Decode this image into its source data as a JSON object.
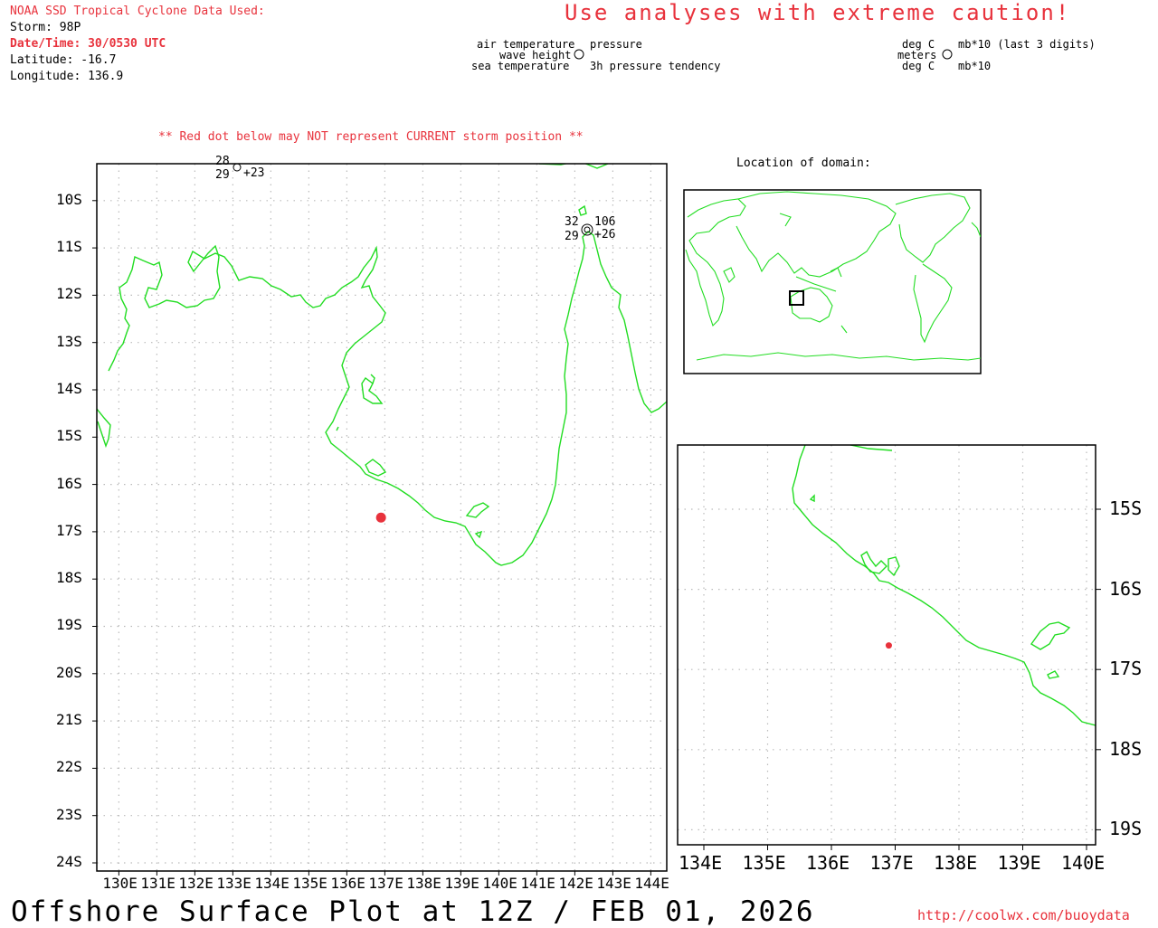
{
  "header": {
    "source": "NOAA SSD Tropical Cyclone Data Used:",
    "storm": "Storm: 98P",
    "datetime": "Date/Time: 30/0530 UTC",
    "latitude": "Latitude: -16.7",
    "longitude": "Longitude: 136.9",
    "caution": "Use analyses with extreme caution!"
  },
  "legend": {
    "air_temperature": "air temperature",
    "wave_height": "wave height",
    "sea_temperature": "sea temperature",
    "pressure": "pressure",
    "pressure_tendency": "3h pressure tendency",
    "deg_c_top": "deg C",
    "meters": "meters",
    "deg_c_bottom": "deg C",
    "mb_last3": "mb*10 (last 3 digits)",
    "mb": "mb*10"
  },
  "main_map": {
    "warning": "** Red dot below may NOT represent CURRENT storm position **",
    "lat_labels": [
      "10S",
      "11S",
      "12S",
      "13S",
      "14S",
      "15S",
      "16S",
      "17S",
      "18S",
      "19S",
      "20S",
      "21S",
      "22S",
      "23S",
      "24S"
    ],
    "lon_labels": [
      "130E",
      "131E",
      "132E",
      "133E",
      "134E",
      "135E",
      "136E",
      "137E",
      "138E",
      "139E",
      "140E",
      "141E",
      "142E",
      "143E",
      "144E"
    ],
    "stations": [
      {
        "id": "station-a",
        "air_temp": "28",
        "sea_temp": "29",
        "tendency": "+23",
        "pressure": "",
        "wave": ""
      },
      {
        "id": "station-b",
        "air_temp": "32",
        "sea_temp": "29",
        "tendency": "+26",
        "pressure": "106",
        "wave": ""
      }
    ],
    "storm_position": {
      "lat": -16.7,
      "lon": 136.9,
      "color": "#e8323c"
    }
  },
  "inset": {
    "title": "Location of domain:"
  },
  "zoom_map": {
    "lat_labels": [
      "15S",
      "16S",
      "17S",
      "18S",
      "19S"
    ],
    "lon_labels": [
      "134E",
      "135E",
      "136E",
      "137E",
      "138E",
      "139E",
      "140E"
    ]
  },
  "footer": {
    "title": "Offshore Surface Plot at 12Z / FEB 01, 2026",
    "url": "http://coolwx.com/buoydata"
  },
  "colors": {
    "coastline": "#22dd22",
    "accent_red": "#e8323c",
    "grid": "#bbbbbb"
  }
}
